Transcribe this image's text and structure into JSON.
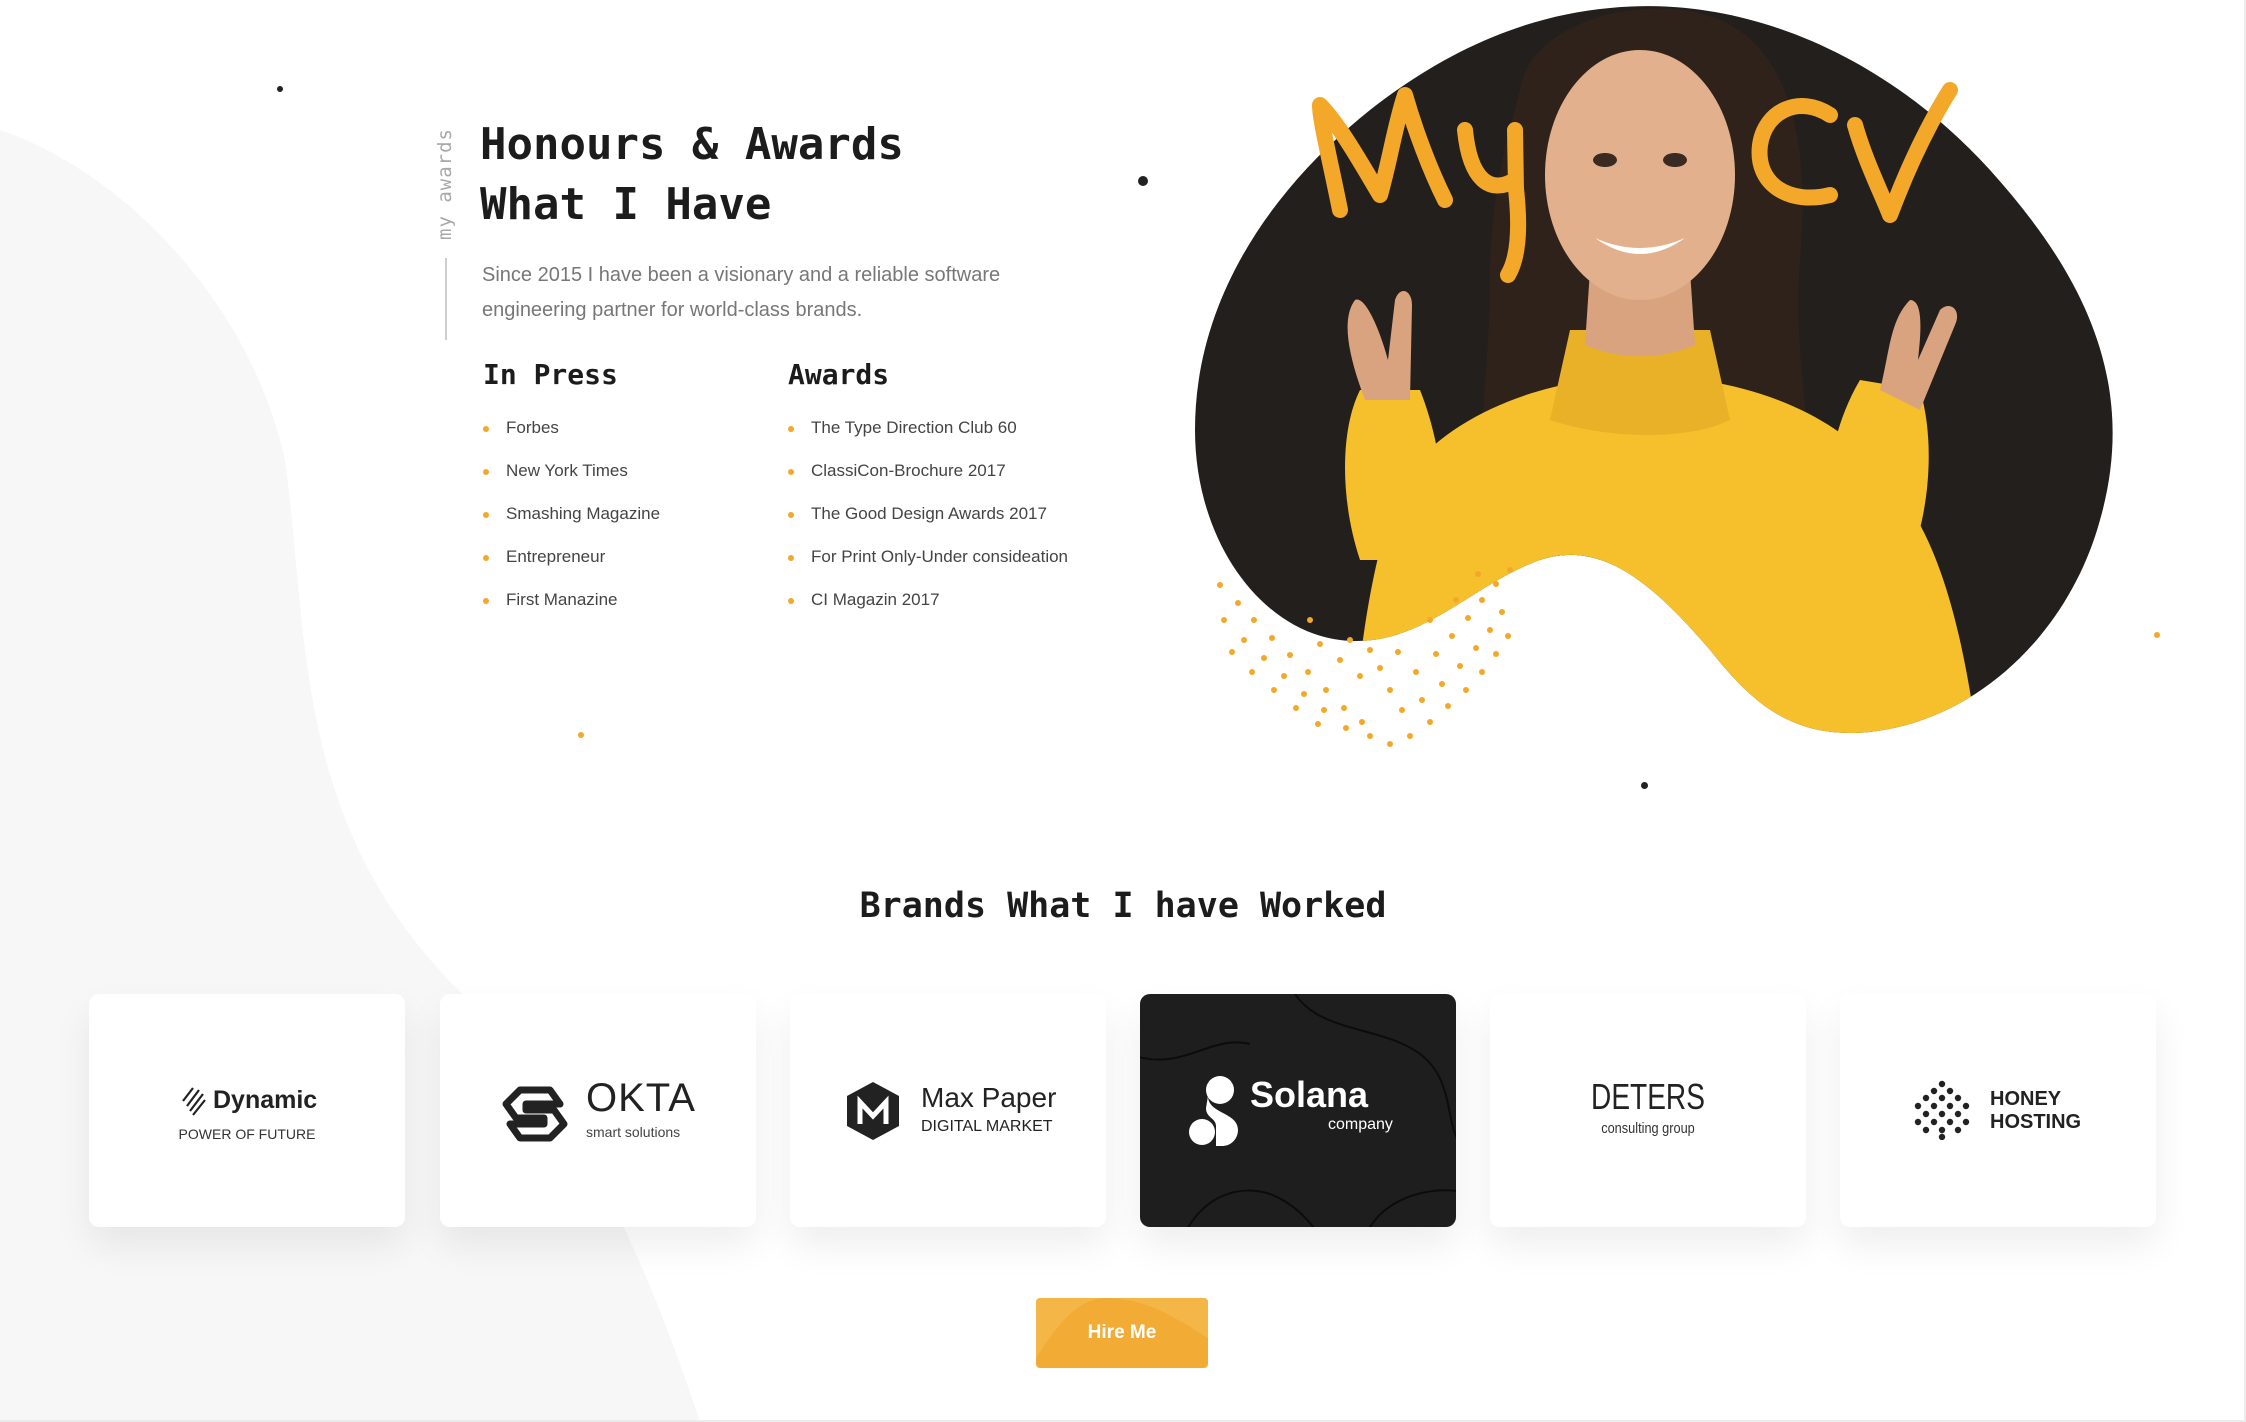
{
  "awards_section": {
    "side_label": "my awards",
    "heading_line1": "Honours & Awards",
    "heading_line2": "What I Have",
    "intro_line1": "Since 2015 I have been a visionary and a reliable software",
    "intro_line2": "engineering partner for world-class brands.",
    "in_press": {
      "title": "In Press",
      "items": [
        "Forbes",
        "New York Times",
        "Smashing Magazine",
        "Entrepreneur",
        "First Manazine"
      ]
    },
    "awards": {
      "title": "Awards",
      "items": [
        "The Type Direction Club 60",
        "ClassiCon-Brochure 2017",
        "The Good Design Awards 2017",
        "For Print Only-Under consideation",
        "CI Magazin 2017"
      ]
    }
  },
  "hero": {
    "handwritten_left": "My",
    "handwritten_right": "CV"
  },
  "brands_section": {
    "title": "Brands What I have Worked",
    "brands": [
      {
        "name": "Dynamic",
        "tagline": "POWER OF FUTURE",
        "icon": "striped-diamond-icon"
      },
      {
        "name": "OKTA",
        "tagline": "smart solutions",
        "icon": "hexagon-s-icon"
      },
      {
        "name": "Max Paper",
        "tagline": "DIGITAL MARKET",
        "icon": "m-hexagon-icon"
      },
      {
        "name": "Solana",
        "tagline": "company",
        "icon": "s-blob-icon"
      },
      {
        "name": "DETERS",
        "tagline": "consulting group",
        "icon": ""
      },
      {
        "name": "HONEY",
        "tagline": "HOSTING",
        "icon": "dot-cluster-icon"
      }
    ]
  },
  "cta": {
    "hire_label": "Hire Me"
  },
  "colors": {
    "accent": "#f3a82a",
    "text_dark": "#1c1c1c",
    "text_muted": "#777777",
    "card_dark": "#1e1e1e",
    "background_blob": "#f7f7f7"
  }
}
